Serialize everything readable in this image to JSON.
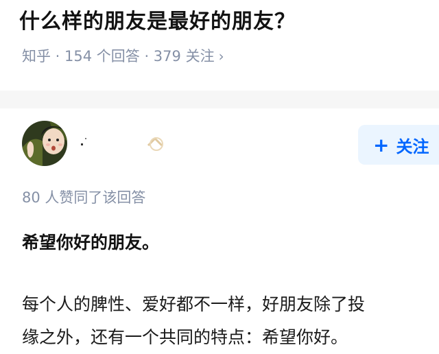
{
  "question": {
    "title": "什么样的朋友是最好的朋友？",
    "meta": "知乎 · 154 个回答 · 379 关注"
  },
  "author": {
    "follow_label": "关注",
    "icons": {
      "follow": "plus-icon",
      "meta_chevron": "chevron-right-icon"
    }
  },
  "answer": {
    "vote_summary": "80 人赞同了该回答",
    "heading": "希望你好的朋友。",
    "lines": [
      "每个人的脾性、爱好都不一样，好朋友除了投",
      "缘之外，还有一个共同的特点：希望你好。"
    ]
  },
  "colors": {
    "accent": "#0066ff",
    "follow_bg": "#ebf5ff",
    "meta_gray": "#8590a6"
  }
}
